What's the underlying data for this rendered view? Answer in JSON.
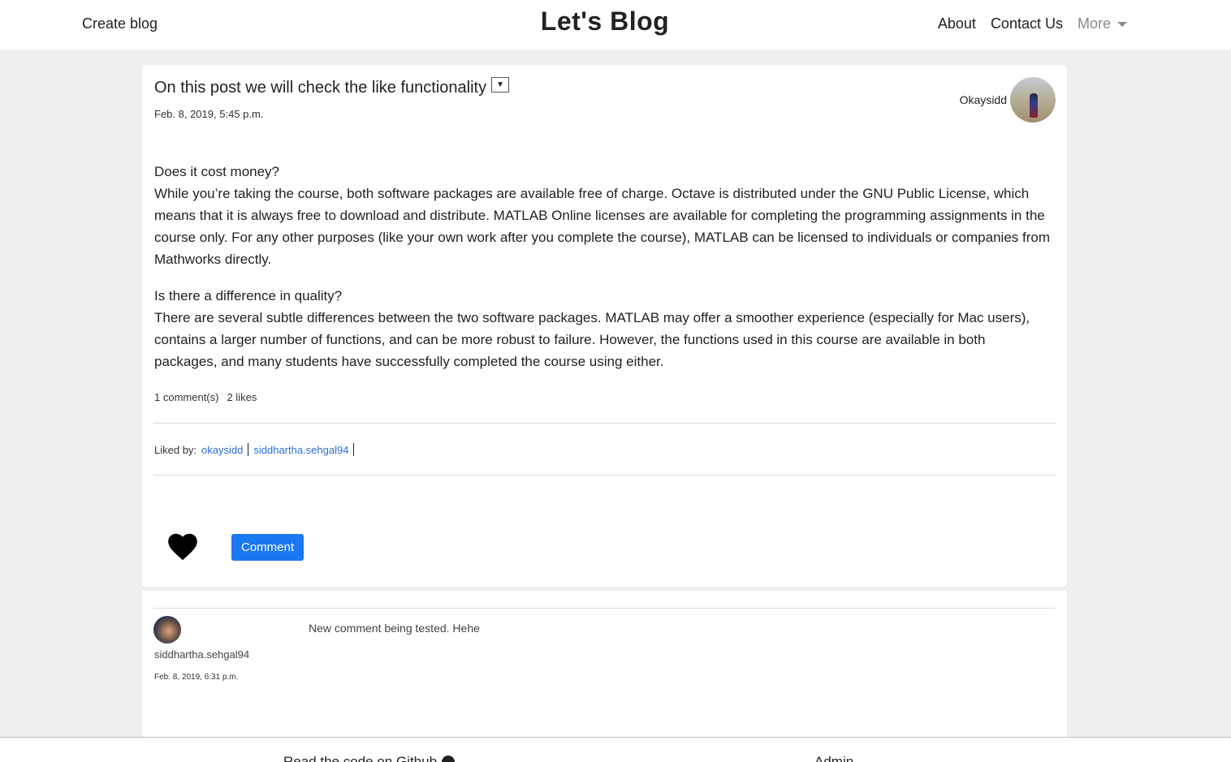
{
  "navbar": {
    "create_label": "Create blog",
    "brand": "Let's Blog",
    "links": [
      "About",
      "Contact Us"
    ],
    "more_label": "More"
  },
  "post": {
    "title": "On this post we will check the like functionality",
    "title_dropdown_glyph": "▼",
    "date": "Feb. 8, 2019, 5:45 p.m.",
    "author": "Okaysidd",
    "paragraphs": [
      "Does it cost money?\nWhile you’re taking the course, both software packages are available free of charge. Octave is distributed under the GNU Public License, which means that it is always free to download and distribute. MATLAB Online licenses are available for completing the programming assignments in the course only. For any other purposes (like your own work after you complete the course), MATLAB can be licensed to individuals or companies from Mathworks directly.",
      "Is there a difference in quality?\nThere are several subtle differences between the two software packages. MATLAB may offer a smoother experience (especially for Mac users), contains a larger number of functions, and can be more robust to failure. However, the functions used in this course are available in both packages, and many students have successfully completed the course using either."
    ],
    "comments_count": "1 comment(s)",
    "likes_count": "2 likes",
    "liked_by_label": "Liked by:",
    "liked_by": [
      "okaysidd",
      "siddhartha.sehgal94"
    ],
    "comment_button": "Comment"
  },
  "comments": [
    {
      "user": "siddhartha.sehgal94",
      "date": "Feb. 8, 2019, 6:31 p.m.",
      "text": "New comment being tested. Hehe"
    }
  ],
  "footer": {
    "github_label": "Read the code on Github",
    "admin_label": "Admin"
  },
  "colors": {
    "accent": "#1a78f2",
    "link": "#2a6fdb",
    "background": "#efefef"
  }
}
